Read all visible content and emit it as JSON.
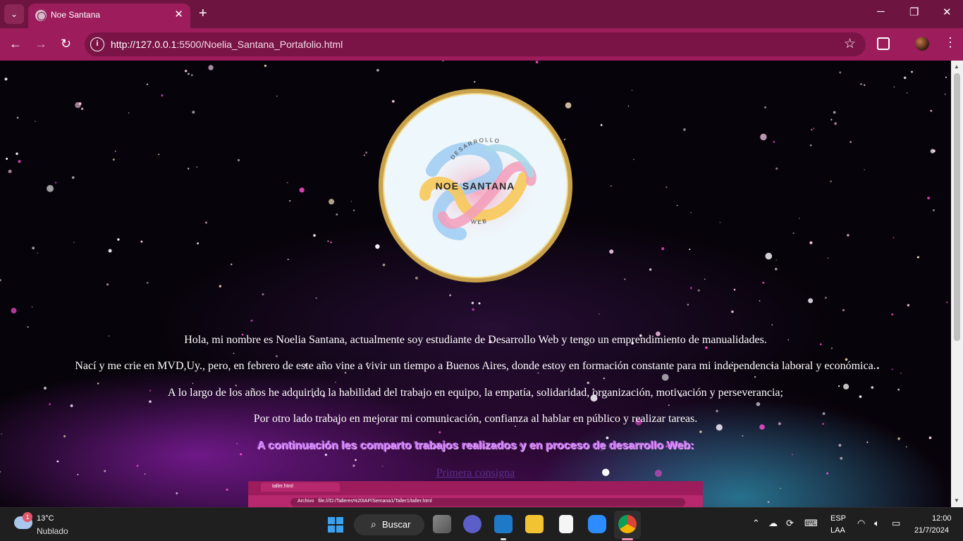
{
  "browser": {
    "tab_title": "Noe Santana",
    "tab_close": "✕",
    "new_tab": "+",
    "url_host": "http://127.0.0.1",
    "url_rest": ":5500/Noelia_Santana_Portafolio.html",
    "window_controls": {
      "minimize": "─",
      "maximize": "❐",
      "close": "✕"
    }
  },
  "page": {
    "logo": {
      "top_text": "DESARROLLO",
      "name": "NOE SANTANA",
      "bottom_text": "WEB"
    },
    "paragraphs": [
      "Hola, mi nombre es Noelia Santana, actualmente soy estudiante de Desarrollo Web y tengo un emprendimiento de manualidades.",
      "Nací y me crie en MVD,Uy., pero, en febrero de este año vine a vivir un tiempo a Buenos Aires, donde estoy en formación constante para mi independencia laboral y económica.",
      "A lo largo de los años he adquirido la habilidad del trabajo en equipo, la empatía, solidaridad, organización, motivación y perseverancia;",
      "Por otro lado trabajo en mejorar mi comunicación, confianza al hablar en público y realizar tareas."
    ],
    "headline": "A continuación les comparto trabajos realizados y en proceso de desarrollo Web:",
    "link_text": "Primera consigna",
    "preview": {
      "tab_title": "taller.html",
      "address_label": "Archivo",
      "address": "file:///D:/Talleres%20IAP/Semana1/Taller1/taller.html"
    }
  },
  "taskbar": {
    "weather_badge": "1",
    "temperature": "13°C",
    "condition": "Nublado",
    "search_label": "Buscar",
    "lang_top": "ESP",
    "lang_bottom": "LAA",
    "time": "12:00",
    "date": "21/7/2024"
  },
  "colors": {
    "chrome": "#9c1c5c",
    "tabbar": "#6e1440",
    "logo_ring": "#c9a14a",
    "headline": "#c77df0",
    "link": "#5a2d8a"
  }
}
